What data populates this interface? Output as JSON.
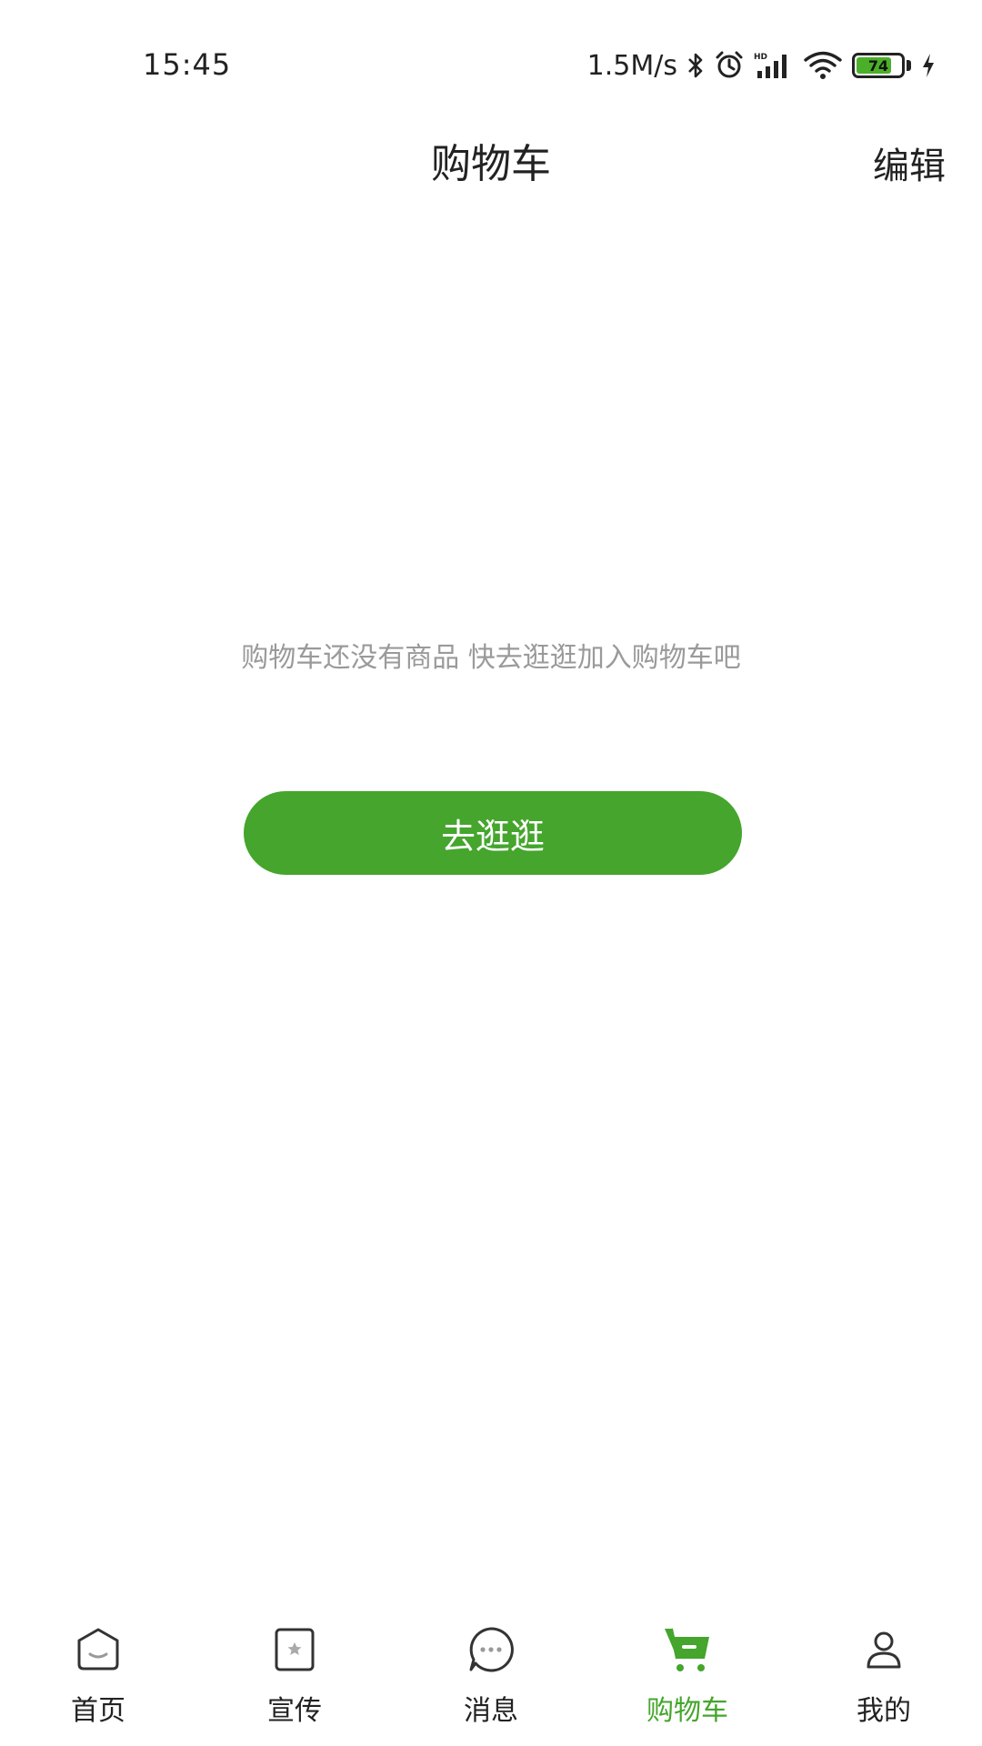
{
  "status_bar": {
    "time": "15:45",
    "network_speed": "1.5M/s",
    "battery_level": "74",
    "icons": [
      "bluetooth-icon",
      "alarm-icon",
      "hd-signal-icon",
      "wifi-icon",
      "battery-icon",
      "charging-icon"
    ]
  },
  "header": {
    "title": "购物车",
    "edit_label": "编辑"
  },
  "empty_state": {
    "message": "购物车还没有商品 快去逛逛加入购物车吧",
    "button_label": "去逛逛"
  },
  "bottom_nav": {
    "items": [
      {
        "label": "首页",
        "icon": "home-icon",
        "active": false
      },
      {
        "label": "宣传",
        "icon": "promo-icon",
        "active": false
      },
      {
        "label": "消息",
        "icon": "message-icon",
        "active": false
      },
      {
        "label": "购物车",
        "icon": "cart-icon",
        "active": true
      },
      {
        "label": "我的",
        "icon": "profile-icon",
        "active": false
      }
    ]
  },
  "colors": {
    "accent": "#45a52d",
    "muted_text": "#9a9a9a",
    "text": "#222222",
    "background": "#ffffff"
  }
}
